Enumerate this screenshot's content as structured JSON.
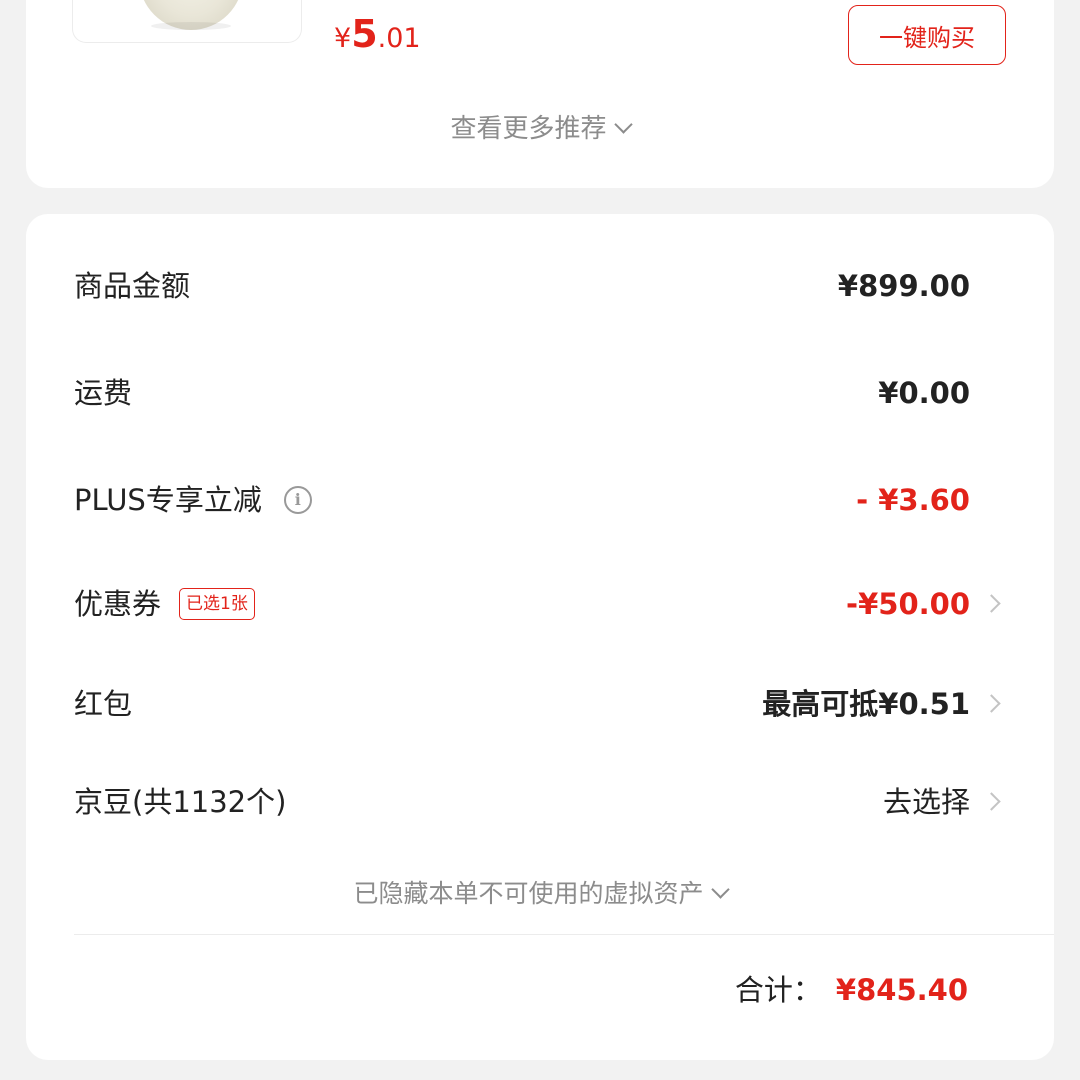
{
  "recommend": {
    "product": {
      "image_icon": "product-jar-image",
      "price_symbol": "¥",
      "price_int": "5",
      "price_dec": ".01"
    },
    "buy_button_label": "一键购买",
    "more_label": "查看更多推荐"
  },
  "summary": {
    "goods_amount": {
      "label": "商品金额",
      "value": "¥899.00"
    },
    "shipping": {
      "label": "运费",
      "value": "¥0.00"
    },
    "plus_discount": {
      "label": "PLUS专享立减",
      "value": "- ¥3.60"
    },
    "coupon": {
      "label": "优惠券",
      "badge": "已选1张",
      "value": "-¥50.00"
    },
    "red_packet": {
      "label": "红包",
      "value": "最高可抵¥0.51"
    },
    "jd_beans": {
      "label": "京豆(共1132个)",
      "value": "去选择"
    },
    "hidden_assets": "已隐藏本单不可使用的虚拟资产",
    "total": {
      "label": "合计：",
      "value": "¥845.40"
    }
  },
  "colors": {
    "accent": "#e2231a",
    "muted": "#8c8c8c",
    "background": "#f2f2f2",
    "card": "#ffffff"
  }
}
